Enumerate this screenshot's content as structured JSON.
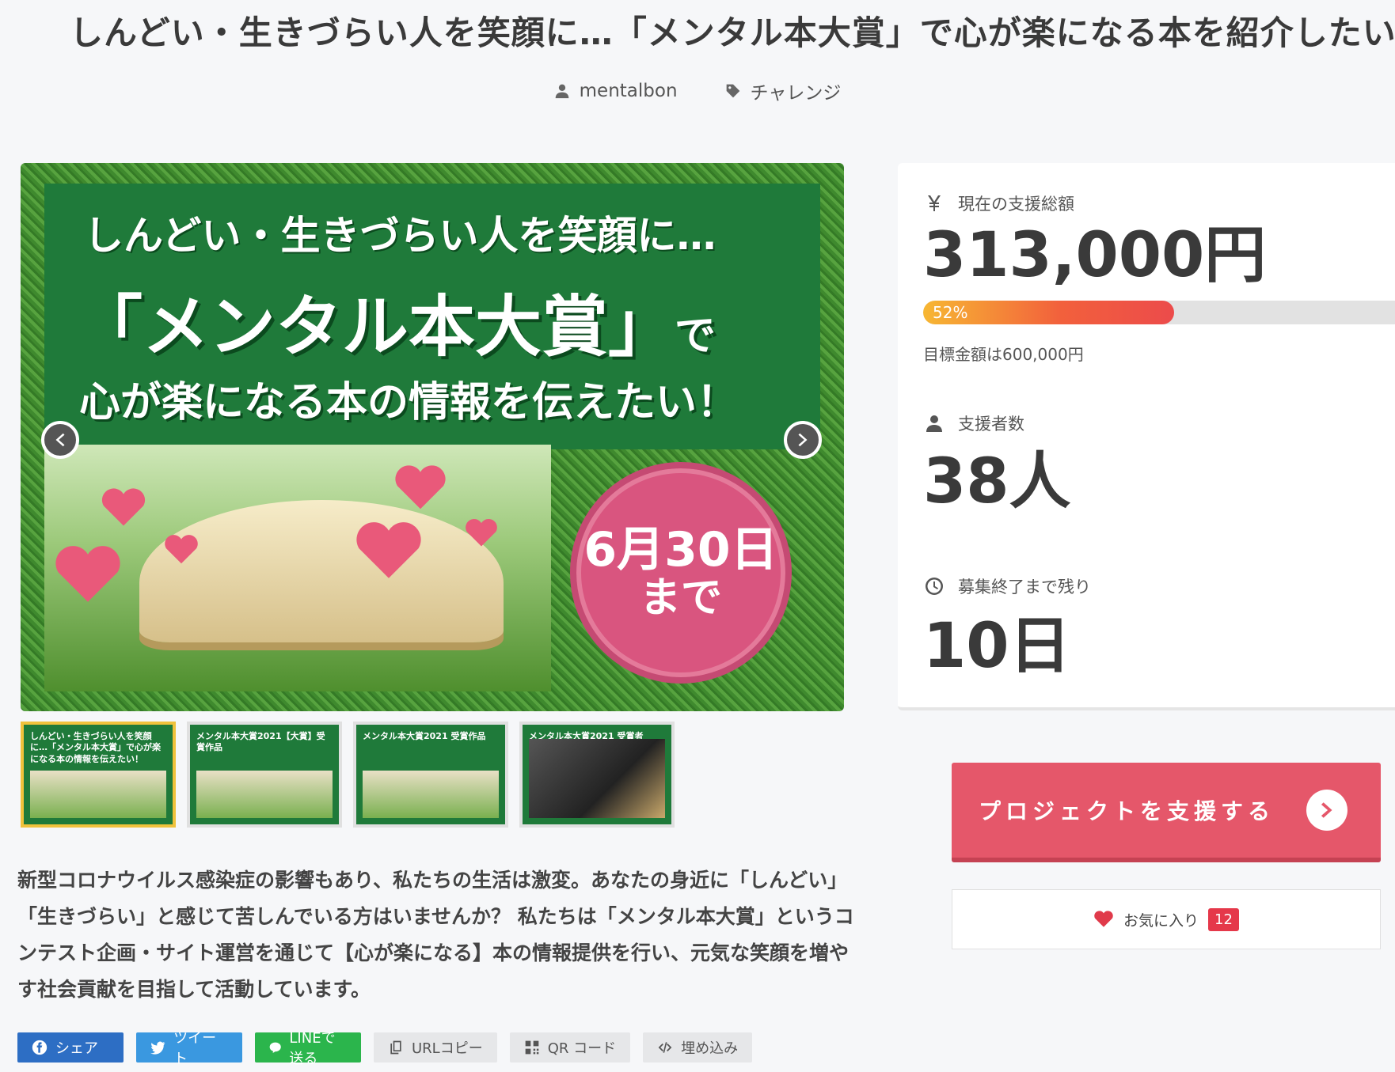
{
  "page": {
    "title": "しんどい・生きづらい人を笑顔に…「メンタル本大賞」で心が楽になる本を紹介したい！",
    "author": "mentalbon",
    "tag": "チャレンジ"
  },
  "hero": {
    "line1": "しんどい・生きづらい人を笑顔に…",
    "line2": "「メンタル本大賞」",
    "line2_suffix": "で",
    "line3": "心が楽になる本の情報を伝えたい！",
    "deadline_date": "6月30日",
    "deadline_suffix": "まで"
  },
  "thumbnails": [
    {
      "text": "しんどい・生きづらい人を笑顔に…「メンタル本大賞」で心が楽になる本の情報を伝えたい！",
      "active": true
    },
    {
      "text": "メンタル本大賞2021【大賞】受賞作品",
      "active": false
    },
    {
      "text": "メンタル本大賞2021 受賞作品",
      "active": false
    },
    {
      "text": "メンタル本大賞2021 受賞者",
      "active": false
    }
  ],
  "description": "新型コロナウイルス感染症の影響もあり、私たちの生活は激変。あなたの身近に「しんどい」「生きづらい」と感じて苦しんでいる方はいませんか？ 私たちは「メンタル本大賞」というコンテスト企画・サイト運営を通じて【心が楽になる】本の情報提供を行い、元気な笑顔を増やす社会貢献を目指して活動しています。",
  "share": {
    "facebook": "シェア",
    "twitter": "ツイート",
    "line": "LINEで送る",
    "url_copy": "URLコピー",
    "qr": "QR コード",
    "embed": "埋め込み"
  },
  "stats": {
    "total_label": "現在の支援総額",
    "total_value": "313,000円",
    "progress_pct": 52,
    "progress_label": "52%",
    "goal_text": "目標金額は600,000円",
    "backers_label": "支援者数",
    "backers_value": "38人",
    "remaining_label": "募集終了まで残り",
    "remaining_value": "10日"
  },
  "actions": {
    "support": "プロジェクトを支援する",
    "favorite": "お気に入り",
    "favorite_count": "12"
  },
  "colors": {
    "accent": "#e5576a",
    "banner_green": "#1f7a3a",
    "badge_red": "#e5384a"
  }
}
